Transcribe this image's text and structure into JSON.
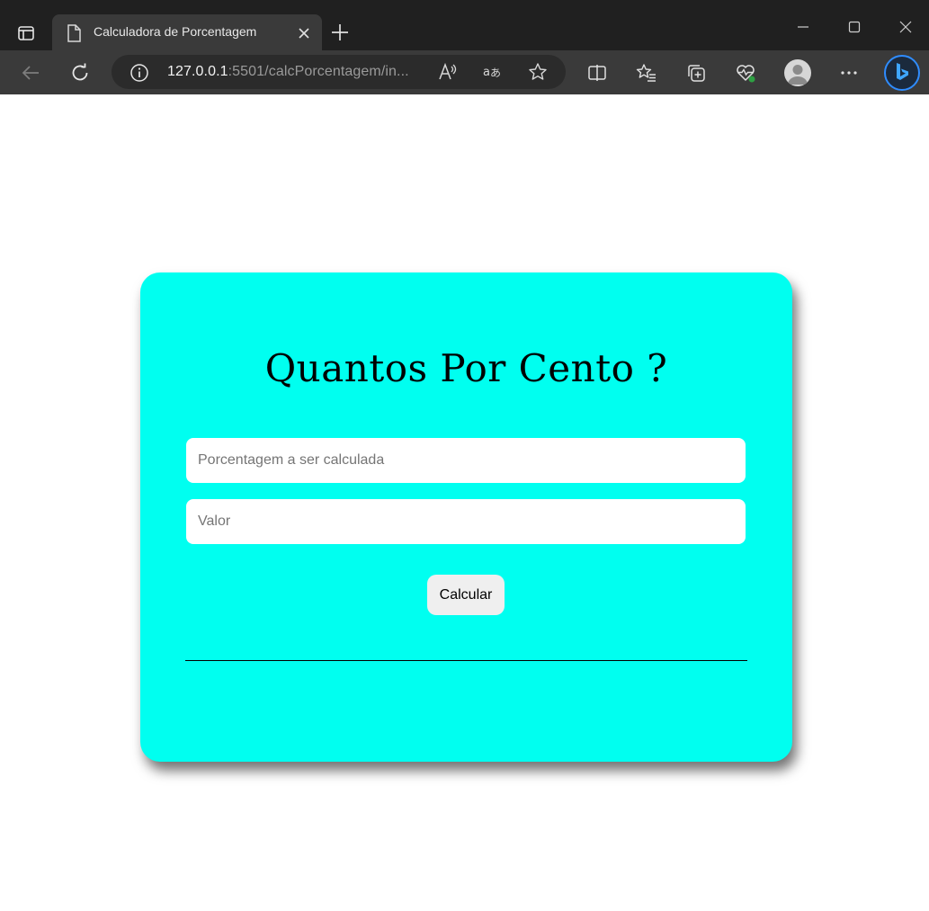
{
  "browser": {
    "tab": {
      "title": "Calculadora de Porcentagem"
    },
    "address": {
      "host": "127.0.0.1",
      "rest": ":5501/calcPorcentagem/in..."
    },
    "icons": {
      "tab_actions": "tab-actions-icon",
      "page": "document-icon",
      "close_tab": "close-icon",
      "new_tab": "plus-icon",
      "minimize": "minimize-icon",
      "maximize": "maximize-icon",
      "close_window": "close-window-icon",
      "back": "back-arrow-icon",
      "refresh": "refresh-icon",
      "site_info": "info-icon",
      "read_aloud": "read-aloud-icon",
      "translate": "translate-icon",
      "favorite": "star-icon",
      "split_screen": "split-screen-icon",
      "favorites": "favorites-list-icon",
      "collections": "collections-icon",
      "browser_essentials": "heart-pulse-icon",
      "profile": "profile-avatar",
      "more": "more-icon",
      "copilot": "bing-icon"
    }
  },
  "page": {
    "heading": "Quantos Por Cento ?",
    "percent_input": {
      "placeholder": "Porcentagem a ser calculada",
      "value": ""
    },
    "value_input": {
      "placeholder": "Valor",
      "value": ""
    },
    "calculate_label": "Calcular",
    "result": ""
  },
  "colors": {
    "card_background": "#00fff0",
    "tabbar": "#202020",
    "toolbar": "#3a3a3a"
  }
}
